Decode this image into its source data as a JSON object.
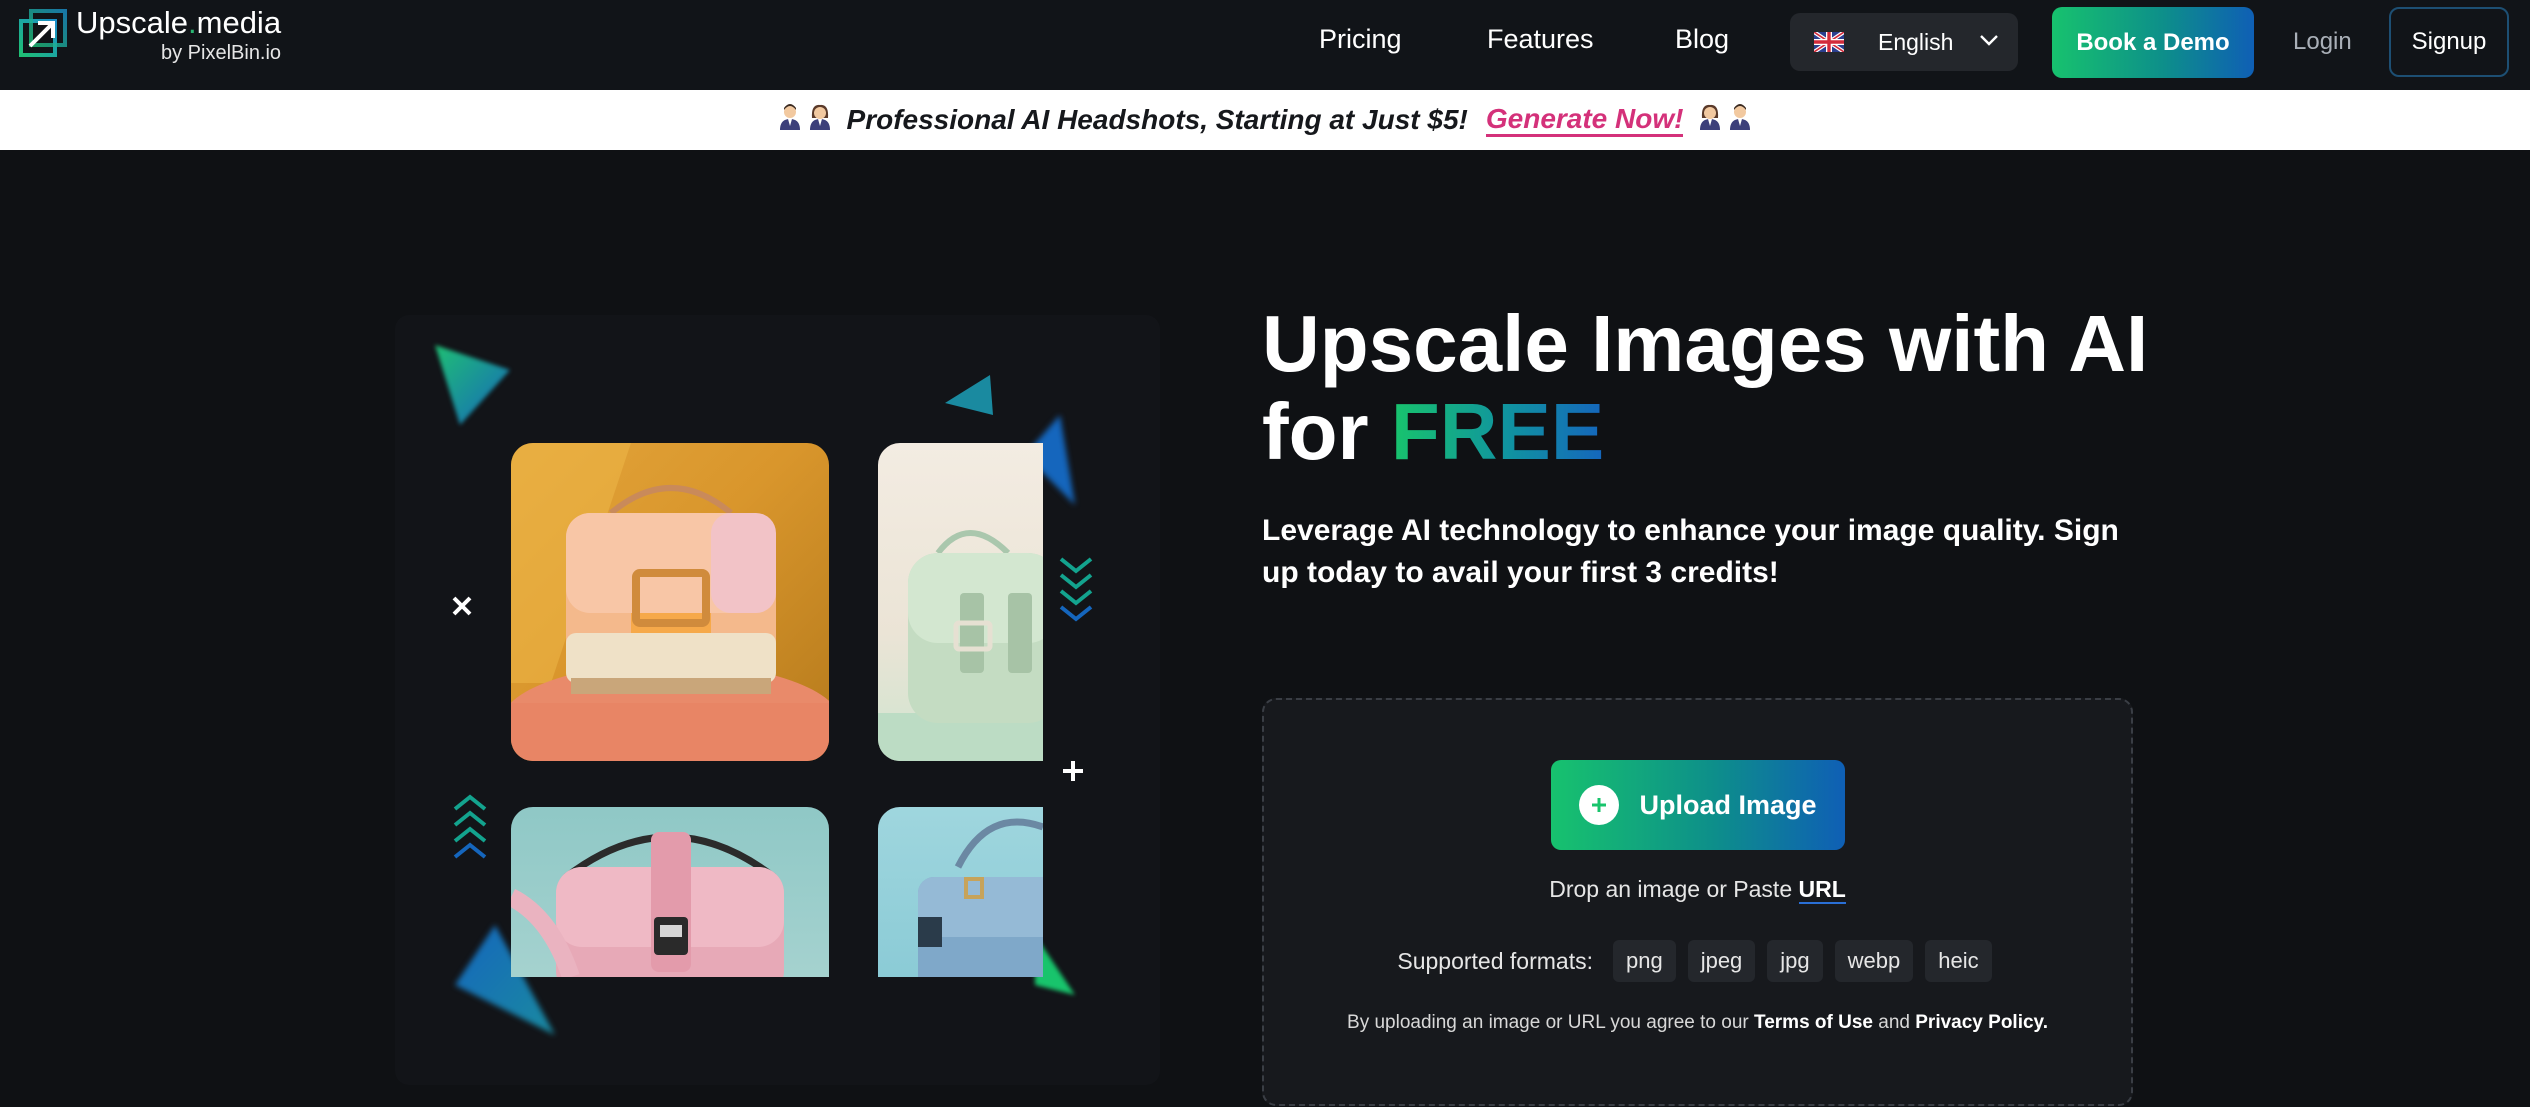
{
  "brand": {
    "name_part1": "Upscale",
    "name_dot": ".",
    "name_part2": "media",
    "sub": "by PixelBin.io"
  },
  "nav": {
    "links": [
      "Pricing",
      "Features",
      "Blog"
    ],
    "language": "English",
    "demo": "Book a Demo",
    "login": "Login",
    "signup": "Signup"
  },
  "banner": {
    "text": "Professional AI Headshots, Starting at Just $5!",
    "link": "Generate Now!"
  },
  "hero": {
    "title_line1": "Upscale Images with AI",
    "title_for": "for ",
    "title_free": "FREE",
    "subtitle": "Leverage AI technology to enhance your image quality. Sign up today to avail your first 3 credits!"
  },
  "upload": {
    "button": "Upload Image",
    "drop_text": "Drop an image or Paste ",
    "drop_url": "URL",
    "formats_label": "Supported formats:",
    "formats": [
      "png",
      "jpeg",
      "jpg",
      "webp",
      "heic"
    ],
    "terms_prefix": "By uploading an image or URL you agree to our ",
    "terms_link": "Terms of Use",
    "terms_and": " and ",
    "privacy_link": "Privacy Policy."
  },
  "colors": {
    "accent_green": "#18c46c",
    "accent_blue": "#1566bd",
    "banner_link": "#d4317a"
  },
  "icons": [
    "logo-icon",
    "flag-uk-icon",
    "chevron-down-icon",
    "plus-icon",
    "close-icon",
    "chevrons-down-icon",
    "chevrons-up-icon"
  ]
}
